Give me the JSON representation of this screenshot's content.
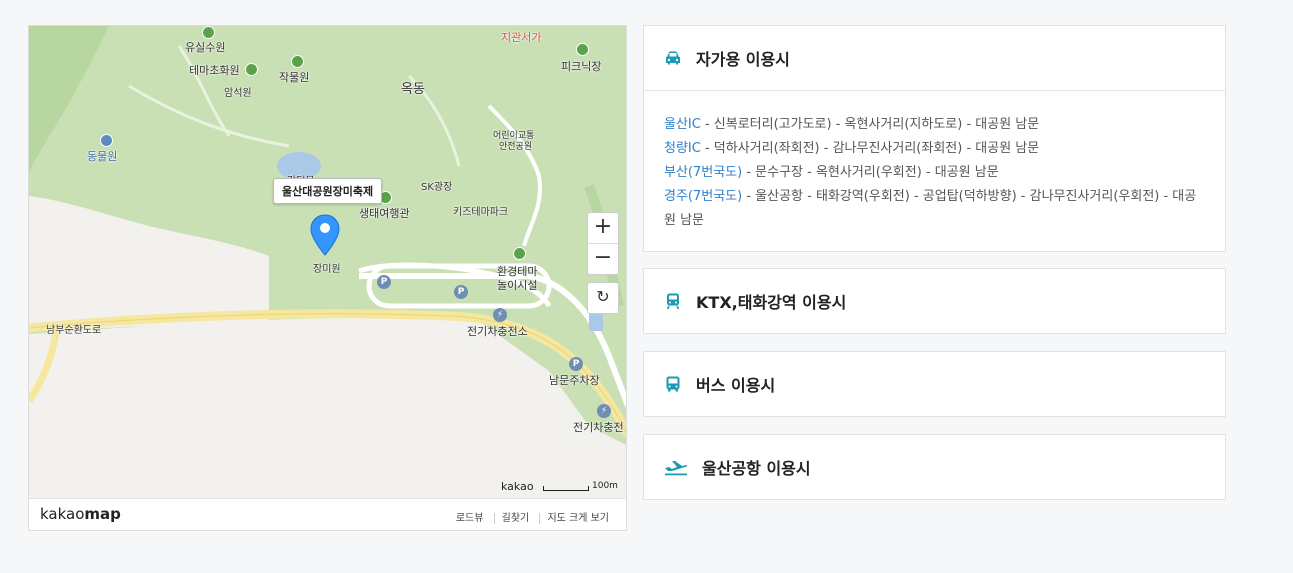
{
  "map": {
    "labels": {
      "yusil": "유실수원",
      "tema": "테마초화원",
      "jakmul": "작물원",
      "amseok": "암석원",
      "okdong": "옥동",
      "gwansi": "지관서가",
      "picnic": "피크닉장",
      "zoo": "동물원",
      "kidstraffic1": "어린이교통",
      "kidstraffic2": "안전공원",
      "kangdo": "강덕무",
      "sk": "SK광장",
      "saengtae": "생태여행관",
      "kids": "키즈테마파크",
      "rose": "장미원",
      "envtheme1": "환경테마",
      "envtheme2": "놀이시설",
      "nambu": "남부순환도로",
      "charging": "전기차충전소",
      "southparking": "남문주차장",
      "charging2": "전기차충전"
    },
    "tooltip": "울산대공원장미축제",
    "zoom_in": "+",
    "zoom_out": "−",
    "refresh": "↻",
    "scale_brand": "kakao",
    "scale_label": "100m",
    "logo_a": "kakao",
    "logo_b": "map",
    "footer_links": [
      "로드뷰",
      "길찾기",
      "지도 크게 보기"
    ]
  },
  "panels": [
    {
      "title": "자가용 이용시",
      "icon": "car-icon",
      "routes": [
        {
          "name": "울산IC",
          "path": " - 신복로터리(고가도로) - 옥현사거리(지하도로) - 대공원 남문"
        },
        {
          "name": "청량IC",
          "path": " - 덕하사거리(좌회전) - 감나무진사거리(좌회전) - 대공원 남문"
        },
        {
          "name": "부산(7번국도)",
          "path": " - 문수구장 - 옥현사거리(우회전) - 대공원 남문"
        },
        {
          "name": "경주(7번국도)",
          "path": " - 울산공항 - 태화강역(우회전) - 공업탑(덕하방향) - 감나무진사거리(우회전) - 대공원 남문"
        }
      ]
    },
    {
      "title": "KTX,태화강역 이용시",
      "icon": "train-icon"
    },
    {
      "title": "버스 이용시",
      "icon": "bus-icon"
    },
    {
      "title": "울산공항 이용시",
      "icon": "airplane-icon"
    }
  ],
  "colors": {
    "accent": "#2f7fd0",
    "icon": "#1a9bb5",
    "park": "#c8dfb4"
  }
}
